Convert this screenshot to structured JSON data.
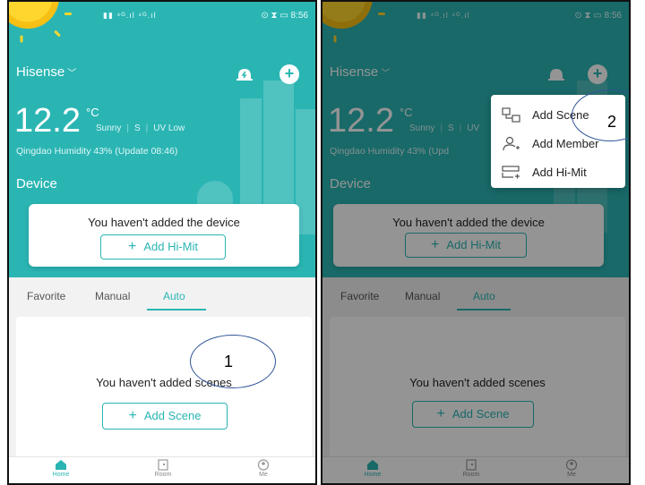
{
  "colors": {
    "teal": "#2ab5b3",
    "overlay": "rgba(0,0,0,0.42)",
    "callout": "#2f5597"
  },
  "left": {
    "status": {
      "signal": "▮▮ ⁴ᴳ.ıl ⁴ᴳ.ıl",
      "right": "⊙ ⧗ ▭ 8:56"
    },
    "header": {
      "home": "Hisense",
      "bell_icon": "bell-icon",
      "add_icon": "plus-icon"
    },
    "weather": {
      "temp": "12.2",
      "unit": "°C",
      "condition": "Sunny",
      "wind": "S",
      "uv": "UV Low",
      "info": "Qingdao   Humidity 43%  (Update 08:46)"
    },
    "device": {
      "title": "Device",
      "empty_text": "You haven't added the device",
      "add_label": "Add Hi-Mit"
    },
    "tabs": [
      "Favorite",
      "Manual",
      "Auto"
    ],
    "scene": {
      "empty_text": "You haven't added scenes",
      "add_label": "Add Scene"
    },
    "nav": [
      "Home",
      "Room",
      "Me"
    ],
    "callout_number": "1"
  },
  "right": {
    "status": {
      "signal": "▮▮ ⁴ᴳ.ıl ⁴ᴳ.ıl",
      "right": "⊙ ⧗ ▭ 8:56"
    },
    "header": {
      "home": "Hisense"
    },
    "weather": {
      "temp": "12.2",
      "unit": "°C",
      "condition": "Sunny",
      "wind": "S",
      "uv": "UV",
      "info": "Qingdao   Humidity 43%  (Upd"
    },
    "device": {
      "title": "Device",
      "empty_text": "You haven't added the device",
      "add_label": "Add Hi-Mit"
    },
    "tabs": [
      "Favorite",
      "Manual",
      "Auto"
    ],
    "scene": {
      "empty_text": "You haven't added scenes",
      "add_label": "Add Scene"
    },
    "nav": [
      "Home",
      "Room",
      "Me"
    ],
    "menu": [
      {
        "label": "Add Scene",
        "icon": "scene-icon"
      },
      {
        "label": "Add Member",
        "icon": "add-member-icon"
      },
      {
        "label": "Add Hi-Mit",
        "icon": "add-device-icon"
      }
    ],
    "callout_number": "2"
  }
}
